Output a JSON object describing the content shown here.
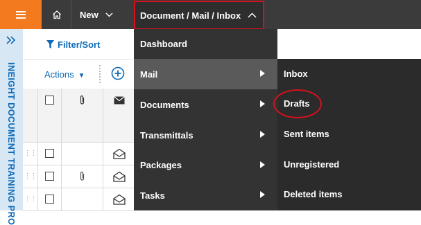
{
  "topbar": {
    "new_label": "New",
    "breadcrumb": "Document / Mail / Inbox",
    "accent": "#f47a20",
    "highlight": "#d6101c"
  },
  "rail": {
    "project_label": "INEIGHT DOCUMENT TRAINING PRO"
  },
  "toolbar": {
    "filter_label": "Filter/Sort",
    "actions_label": "Actions"
  },
  "grid": {
    "columns": [
      "select",
      "attachment",
      "mail"
    ],
    "rows": [
      {
        "has_attachment": false,
        "mail_icon": "open-envelope-icon"
      },
      {
        "has_attachment": true,
        "mail_icon": "open-envelope-icon"
      },
      {
        "has_attachment": false,
        "mail_icon": "open-envelope-icon"
      }
    ]
  },
  "menu": {
    "items": [
      {
        "label": "Dashboard",
        "has_submenu": false
      },
      {
        "label": "Mail",
        "has_submenu": true,
        "active": true
      },
      {
        "label": "Documents",
        "has_submenu": true
      },
      {
        "label": "Transmittals",
        "has_submenu": true
      },
      {
        "label": "Packages",
        "has_submenu": true
      },
      {
        "label": "Tasks",
        "has_submenu": true
      }
    ]
  },
  "submenu": {
    "items": [
      {
        "label": "Inbox"
      },
      {
        "label": "Drafts",
        "circled": true
      },
      {
        "label": "Sent items"
      },
      {
        "label": "Unregistered"
      },
      {
        "label": "Deleted items"
      }
    ]
  }
}
